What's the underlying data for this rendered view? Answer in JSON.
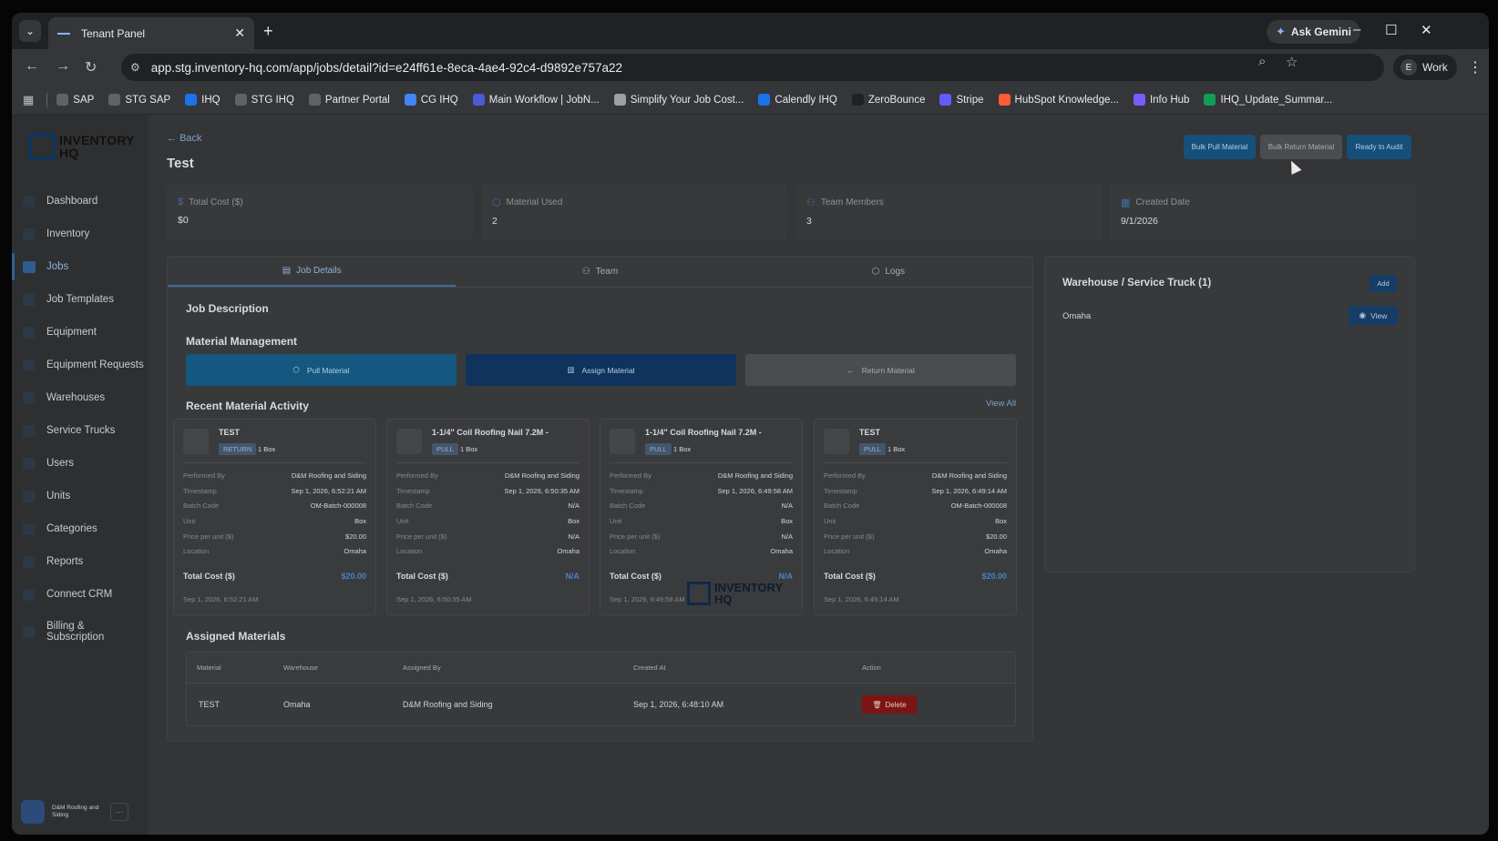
{
  "browser": {
    "tab_title": "Tenant Panel",
    "url": "app.stg.inventory-hq.com/app/jobs/detail?id=e24ff61e-8eca-4ae4-92c4-d9892e757a22",
    "ask_gemini": "Ask Gemini",
    "profile_initial": "E",
    "profile_name": "Work",
    "bookmarks": [
      {
        "label": "SAP",
        "color": "#5f6368"
      },
      {
        "label": "STG SAP",
        "color": "#5f6368"
      },
      {
        "label": "IHQ",
        "color": "#1a73e8"
      },
      {
        "label": "STG IHQ",
        "color": "#5f6368"
      },
      {
        "label": "Partner Portal",
        "color": "#5f6368"
      },
      {
        "label": "CG IHQ",
        "color": "#4285f4"
      },
      {
        "label": "Main Workflow | JobN...",
        "color": "#4a5bd4"
      },
      {
        "label": "Simplify Your Job Cost...",
        "color": "#9aa0a6"
      },
      {
        "label": "Calendly IHQ",
        "color": "#1a73e8"
      },
      {
        "label": "ZeroBounce",
        "color": "#202124"
      },
      {
        "label": "Stripe",
        "color": "#635bff"
      },
      {
        "label": "HubSpot Knowledge...",
        "color": "#ff5c35"
      },
      {
        "label": "Info Hub",
        "color": "#7b5cff"
      },
      {
        "label": "IHQ_Update_Summar...",
        "color": "#0f9d58"
      }
    ]
  },
  "brand": {
    "logo_line1": "INVENTORY",
    "logo_line2": "HQ"
  },
  "sidebar": {
    "items": [
      {
        "label": "Dashboard",
        "icon": "dashboard-icon"
      },
      {
        "label": "Inventory",
        "icon": "inventory-icon"
      },
      {
        "label": "Jobs",
        "icon": "jobs-icon",
        "active": true
      },
      {
        "label": "Job Templates",
        "icon": "job-templates-icon"
      },
      {
        "label": "Equipment",
        "icon": "equipment-icon"
      },
      {
        "label": "Equipment Requests",
        "icon": "equipment-requests-icon"
      },
      {
        "label": "Warehouses",
        "icon": "warehouses-icon"
      },
      {
        "label": "Service Trucks",
        "icon": "truck-icon"
      },
      {
        "label": "Users",
        "icon": "users-icon"
      },
      {
        "label": "Units",
        "icon": "units-icon"
      },
      {
        "label": "Categories",
        "icon": "categories-icon"
      },
      {
        "label": "Reports",
        "icon": "reports-icon"
      },
      {
        "label": "Connect CRM",
        "icon": "crm-icon"
      },
      {
        "label": "Billing & Subscription",
        "icon": "billing-icon"
      }
    ],
    "user_name": "D&M Roofing and Siding",
    "user_more": "···"
  },
  "header": {
    "back": "Back",
    "title": "Test",
    "btn_bulk_pull": "Bulk Pull Material",
    "btn_bulk_return": "Bulk Return Material",
    "btn_ready_audit": "Ready to Audit"
  },
  "stats": [
    {
      "label": "Total Cost ($)",
      "value": "$0",
      "icon": "dollar-icon"
    },
    {
      "label": "Material Used",
      "value": "2",
      "icon": "box-icon"
    },
    {
      "label": "Team Members",
      "value": "3",
      "icon": "team-icon"
    },
    {
      "label": "Created Date",
      "value": "9/1/2026",
      "icon": "calendar-icon"
    }
  ],
  "tabs": {
    "job_details": "Job Details",
    "team": "Team",
    "logs": "Logs"
  },
  "job": {
    "description_title": "Job Description",
    "material_mgmt_title": "Material Management",
    "pull_material": "Pull Material",
    "assign_material": "Assign Material",
    "return_material": "Return Material",
    "recent_activity_title": "Recent Material Activity",
    "view_all": "View All"
  },
  "labels": {
    "performed_by": "Performed By",
    "timestamp": "Timestamp",
    "batch_code": "Batch Code",
    "unit": "Unit",
    "price_per_unit": "Price per unit ($)",
    "location": "Location",
    "total_cost": "Total Cost ($)"
  },
  "activity": [
    {
      "name": "TEST",
      "type": "RETURN",
      "qty": "1 Box",
      "performed_by": "D&M Roofing and Siding",
      "timestamp": "Sep 1, 2026, 6:52:21 AM",
      "batch_code": "OM-Batch-000008",
      "unit": "Box",
      "price": "$20.00",
      "location": "Omaha",
      "total": "$20.00",
      "date": "Sep 1, 2026, 6:52:21 AM"
    },
    {
      "name": "1-1/4\" Coil Roofing Nail 7.2M -",
      "type": "PULL",
      "qty": "1 Box",
      "performed_by": "D&M Roofing and Siding",
      "timestamp": "Sep 1, 2026, 6:50:35 AM",
      "batch_code": "N/A",
      "unit": "Box",
      "price": "N/A",
      "location": "Omaha",
      "total": "N/A",
      "date": "Sep 1, 2026, 6:50:35 AM"
    },
    {
      "name": "1-1/4\" Coil Roofing Nail 7.2M -",
      "type": "PULL",
      "qty": "1 Box",
      "performed_by": "D&M Roofing and Siding",
      "timestamp": "Sep 1, 2026, 6:49:58 AM",
      "batch_code": "N/A",
      "unit": "Box",
      "price": "N/A",
      "location": "Omaha",
      "total": "N/A",
      "date": "Sep 1, 2026, 6:49:58 AM"
    },
    {
      "name": "TEST",
      "type": "PULL",
      "qty": "1 Box",
      "performed_by": "D&M Roofing and Siding",
      "timestamp": "Sep 1, 2026, 6:49:14 AM",
      "batch_code": "OM-Batch-000008",
      "unit": "Box",
      "price": "$20.00",
      "location": "Omaha",
      "total": "$20.00",
      "date": "Sep 1, 2026, 6:49:14 AM"
    }
  ],
  "watermark": {
    "line1": "INVENTORY",
    "line2": "HQ"
  },
  "assigned": {
    "title": "Assigned Materials",
    "headers": [
      "Material",
      "Warehouse",
      "Assigned By",
      "Created At",
      "Action"
    ],
    "rows": [
      {
        "material": "TEST",
        "warehouse": "Omaha",
        "assigned_by": "D&M Roofing and Siding",
        "created_at": "Sep 1, 2026, 6:48:10 AM",
        "action": "Delete"
      }
    ]
  },
  "warehouse_panel": {
    "title": "Warehouse / Service Truck (1)",
    "add": "Add",
    "items": [
      {
        "name": "Omaha",
        "action": "View"
      }
    ]
  }
}
